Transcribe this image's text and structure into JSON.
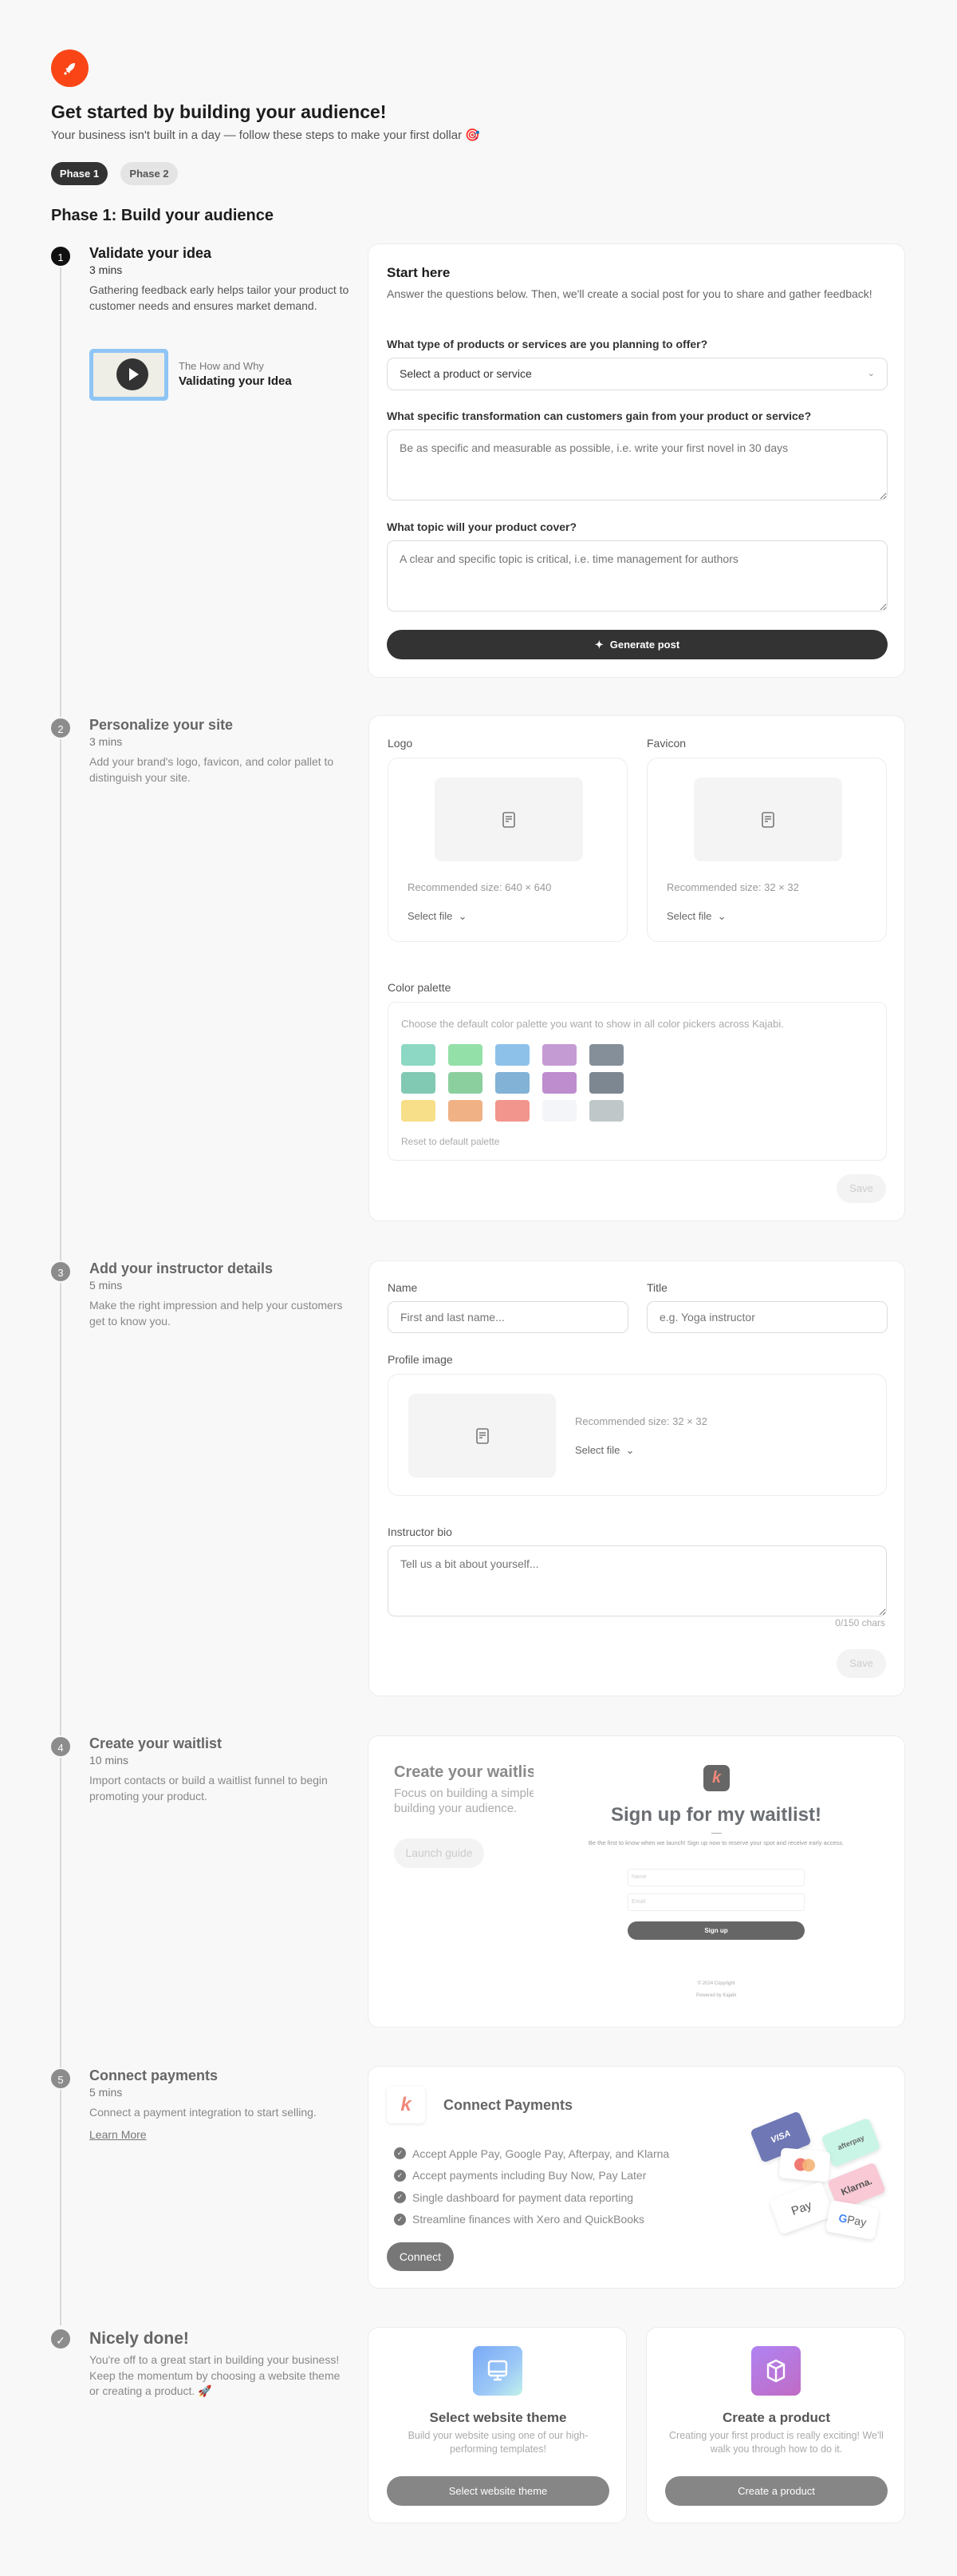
{
  "header": {
    "title": "Get started by building your audience!",
    "subtitle": "Your business isn't built in a day — follow these steps to make your first dollar 🎯",
    "icon": "rocket-icon",
    "accent": "#fa4616"
  },
  "phases": [
    {
      "label": "Phase 1",
      "active": true
    },
    {
      "label": "Phase 2",
      "active": false
    }
  ],
  "phase_heading": "Phase 1: Build your audience",
  "steps": [
    {
      "num": "1",
      "title": "Validate your idea",
      "mins": "3 mins",
      "desc": "Gathering feedback early helps tailor your product to customer needs and ensures market demand.",
      "video": {
        "kicker": "The How and Why",
        "title": "Validating your Idea"
      }
    },
    {
      "num": "2",
      "title": "Personalize your site",
      "mins": "3 mins",
      "desc": "Add your brand's logo, favicon, and color pallet to distinguish your site."
    },
    {
      "num": "3",
      "title": "Add your instructor details",
      "mins": "5 mins",
      "desc": "Make the right impression and help your customers get to know you."
    },
    {
      "num": "4",
      "title": "Create your waitlist",
      "mins": "10 mins",
      "desc": "Import contacts or build a waitlist funnel to begin promoting your product."
    },
    {
      "num": "5",
      "title": "Connect payments",
      "mins": "5 mins",
      "desc": "Connect a payment integration to start selling.",
      "link": "Learn More"
    }
  ],
  "done": {
    "title": "Nicely done!",
    "desc": "You're off to a great start in building your business! Keep the momentum by choosing a website theme or creating a product. 🚀"
  },
  "validate_card": {
    "title": "Start here",
    "desc": "Answer the questions below. Then, we'll create a social post for you to share and gather feedback!",
    "q1": "What type of products or services are you planning to offer?",
    "q1_value": "Select a product or service",
    "q2": "What specific transformation can customers gain from your product or service?",
    "q2_placeholder": "Be as specific and measurable as possible, i.e. write your first novel in 30 days",
    "q3": "What topic will your product cover?",
    "q3_placeholder": "A clear and specific topic is critical, i.e. time management for authors",
    "button": "Generate post"
  },
  "site_card": {
    "logo_label": "Logo",
    "logo_rec": "Recommended size: 640 × 640",
    "favicon_label": "Favicon",
    "favicon_rec": "Recommended size: 32 × 32",
    "select_file": "Select file",
    "palette_label": "Color palette",
    "palette_desc": "Choose the default color palette you want to show in all color pickers across Kajabi.",
    "palette": [
      [
        "#8dd8c4",
        "#93e0a8",
        "#8dc1ea",
        "#c59bd4",
        "#858f9a"
      ],
      [
        "#82c9b3",
        "#8ccf9e",
        "#82b2d6",
        "#bd8dce",
        "#7d8792"
      ],
      [
        "#f7de88",
        "#f0b184",
        "#f2958c",
        "#f3f5f8",
        "#c0c7c9"
      ]
    ],
    "reset": "Reset to default palette",
    "save": "Save"
  },
  "instructor_card": {
    "name_label": "Name",
    "name_placeholder": "First and last name...",
    "title_label": "Title",
    "title_placeholder": "e.g. Yoga instructor",
    "profile_label": "Profile image",
    "profile_rec": "Recommended size: 32 × 32",
    "select_file": "Select file",
    "bio_label": "Instructor bio",
    "bio_placeholder": "Tell us a bit about yourself...",
    "chars": "0/150 chars",
    "save": "Save"
  },
  "waitlist_card": {
    "title": "Create your waitlist",
    "desc_line1": "Focus on building a simple",
    "desc_line2": "building your audience.",
    "button": "Launch guide",
    "preview": {
      "heading": "Sign up for my waitlist!",
      "sub": "Be the first to know when we launch! Sign up now to reserve your spot and receive early access.",
      "name_ph": "Name",
      "email_ph": "Email",
      "button": "Sign up",
      "copyright": "© 2024 Copyright",
      "powered": "Powered by Kajabi"
    }
  },
  "payments_card": {
    "title": "Connect Payments",
    "bullets": [
      "Accept Apple Pay, Google Pay, Afterpay, and Klarna",
      "Accept payments including Buy Now, Pay Later",
      "Single dashboard for payment data reporting",
      "Streamline finances with Xero and QuickBooks"
    ],
    "button": "Connect",
    "cards": {
      "visa": "VISA",
      "afterpay": "afterpay",
      "klarna": "Klarna.",
      "apple": "Pay",
      "google": "Pay"
    }
  },
  "next_cards": [
    {
      "title": "Select website theme",
      "desc": "Build your website using one of our high-performing templates!",
      "button": "Select website theme",
      "icon": "monitor-icon"
    },
    {
      "title": "Create a product",
      "desc": "Creating your first product is really exciting! We'll walk you through how to do it.",
      "button": "Create a product",
      "icon": "box-icon"
    }
  ]
}
